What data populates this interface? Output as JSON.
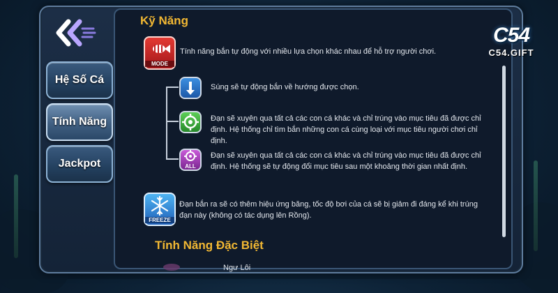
{
  "nav": {
    "back_icon": "double-chevron-left-icon",
    "items": [
      {
        "label": "Hệ Số Cá",
        "active": false
      },
      {
        "label": "Tính Năng",
        "active": true
      },
      {
        "label": "Jackpot",
        "active": false
      }
    ]
  },
  "section_skills": {
    "title": "Kỹ Năng",
    "mode": {
      "icon_label": "MODE",
      "icon": "fishbone-mode-icon",
      "description": "Tính năng bắn tự động với nhiều lựa chọn khác nhau để hỗ trợ người chơi."
    },
    "sub_modes": [
      {
        "icon": "arrow-down-icon",
        "description": "Súng sẽ tự động bắn về hướng được chọn."
      },
      {
        "icon": "crosshair-target-icon",
        "description": "Đạn sẽ xuyên qua tất cả các con cá khác và chỉ trúng vào mục tiêu đã được chỉ định. Hệ thống chỉ tìm bắn những con cá cùng loại với mục tiêu người chơi chỉ định."
      },
      {
        "icon": "crosshair-all-icon",
        "icon_label": "ALL",
        "description": "Đạn sẽ xuyên qua tất cả các con cá khác và chỉ trúng vào mục tiêu đã được chỉ định. Hệ thống sẽ tự động đổi mục tiêu sau một khoảng thời gian nhất định."
      }
    ],
    "freeze": {
      "icon_label": "FREEZE",
      "icon": "snowflake-icon",
      "description": "Đạn bắn ra sẽ có thêm hiệu ứng băng, tốc độ bơi của cá sẽ bị giảm đi đáng kể khi trúng đạn này (không có tác dụng lên Rồng)."
    }
  },
  "section_special": {
    "title": "Tính Năng Đặc Biệt",
    "partial_item": "Ngư Lôi"
  },
  "logo": {
    "brand": "C54",
    "site": "C54.GIFT"
  },
  "colors": {
    "heading": "#f2b833",
    "text": "#e4e8ee",
    "panel_bg": "#0f1a2b"
  }
}
